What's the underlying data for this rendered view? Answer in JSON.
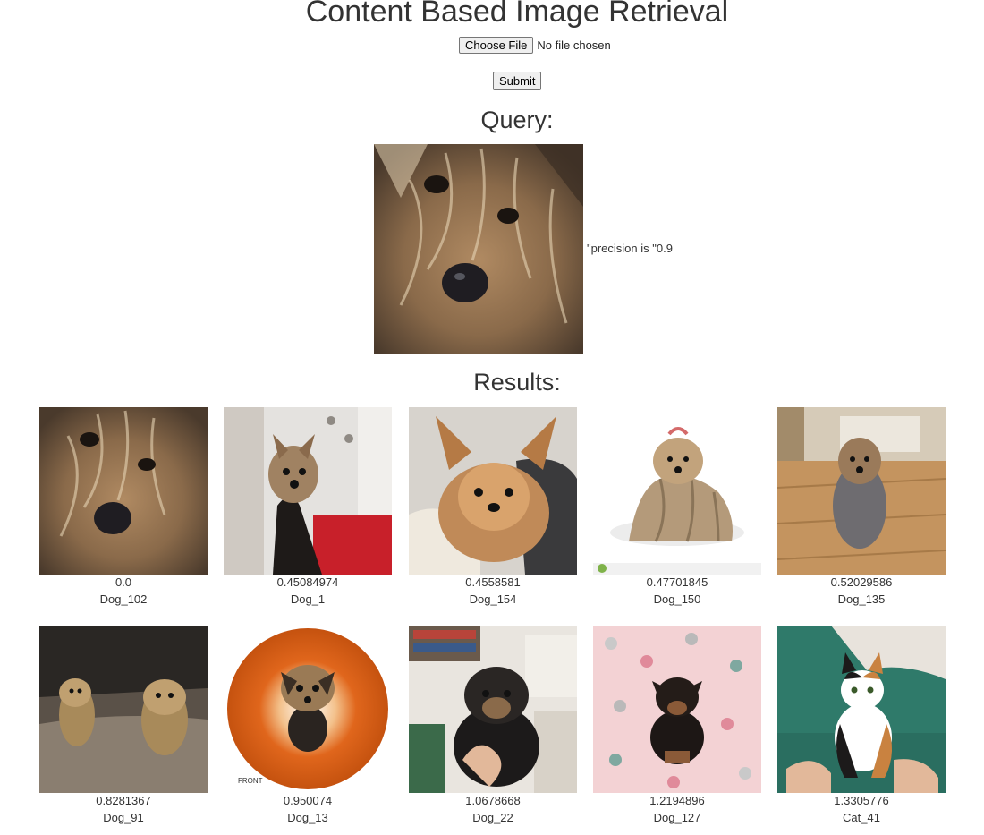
{
  "header": {
    "title": "Content Based Image Retrieval"
  },
  "upload": {
    "choose_label": "Choose File",
    "status": "No file chosen",
    "submit_label": "Submit"
  },
  "query": {
    "heading": "Query:",
    "precision_text": "\"precision is \"0.9"
  },
  "results": {
    "heading": "Results:",
    "items": [
      {
        "score": "0.0",
        "label": "Dog_102"
      },
      {
        "score": "0.45084974",
        "label": "Dog_1"
      },
      {
        "score": "0.4558581",
        "label": "Dog_154"
      },
      {
        "score": "0.47701845",
        "label": "Dog_150"
      },
      {
        "score": "0.52029586",
        "label": "Dog_135"
      },
      {
        "score": "0.8281367",
        "label": "Dog_91"
      },
      {
        "score": "0.950074",
        "label": "Dog_13"
      },
      {
        "score": "1.0678668",
        "label": "Dog_22"
      },
      {
        "score": "1.2194896",
        "label": "Dog_127"
      },
      {
        "score": "1.3305776",
        "label": "Cat_41"
      }
    ]
  }
}
